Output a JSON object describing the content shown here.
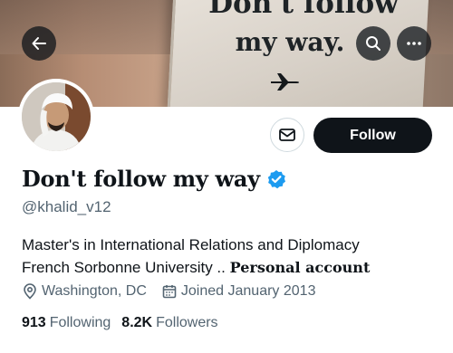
{
  "banner": {
    "image_text_line1": "Don't follow",
    "image_text_line2": "my way.",
    "plane_icon": "airplane-icon"
  },
  "nav": {
    "back_icon": "arrow-left-icon",
    "search_icon": "search-icon",
    "more_icon": "more-horizontal-icon"
  },
  "profile": {
    "display_name": "Don't follow my way",
    "handle": "@khalid_v12",
    "verified": true,
    "verified_color": "#1d9bf0",
    "bio_line1": "Master's in International Relations and Diplomacy",
    "bio_line2_prefix": "French Sorbonne University .. ",
    "bio_line2_suffix": "Personal account",
    "location": "Washington, DC",
    "joined": "Joined January 2013"
  },
  "actions": {
    "message_icon": "mail-icon",
    "follow_label": "Follow"
  },
  "stats": {
    "following_count": "913",
    "following_label": "Following",
    "followers_count": "8.2K",
    "followers_label": "Followers"
  },
  "colors": {
    "text_primary": "#0f1419",
    "text_secondary": "#536471",
    "follow_bg": "#0f1419"
  }
}
